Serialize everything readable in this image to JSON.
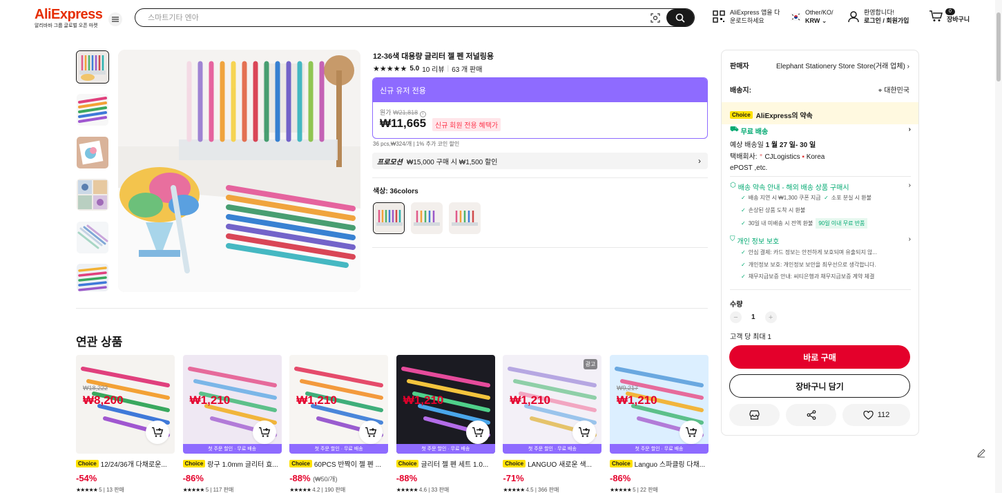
{
  "header": {
    "logo": "AliExpress",
    "logo_tagline": "알리바바 그룹 글로벌 오픈 마켓",
    "search_placeholder": "스마트기타 엔아",
    "app_download_line1": "AliExpress 앱을 다",
    "app_download_line2": "운로드하세요",
    "locale_line1": "Other/KO/",
    "locale_line2": "KRW",
    "account_line1": "환영합니다!",
    "account_line2": "로그인 / 회원가입",
    "cart_count": "0",
    "cart_label": "장바구니"
  },
  "product": {
    "title": "12-36색 대용량 글리터 젤 펜 저널링용",
    "rating": "5.0",
    "reviews": "10 리뷰",
    "sold": "63 개 판매",
    "promo_header": "신규 유저 전용",
    "original_label": "원가",
    "original_price": "₩21,818",
    "price": "₩11,665",
    "new_member_badge": "신규 회원 전용 혜택가",
    "per_pcs": "36 pcs,₩324/개 | 1% 추가 코인 할인",
    "promotion_label": "프로모션",
    "promotion_text": "₩15,000 구매 시 ₩1,500 할인",
    "color_label": "색상: 36colors"
  },
  "panel": {
    "seller_label": "판매자",
    "seller_name": "Elephant Stationery Store Store(거래 업체)",
    "ship_to_label": "배송지:",
    "ship_to_value": "대한민국",
    "choice_badge": "Choice",
    "choice_title": "AliExpress의 약속",
    "free_shipping": "무료 배송",
    "delivery_prefix": "예상 배송일",
    "delivery_dates": "1 월 27 일- 30 일",
    "courier_prefix": "택배회사:",
    "courier_1": "CJLogistics",
    "courier_2": "Korea",
    "courier_3": "ePOST ,etc.",
    "guarantee_title": "배송 약속 안내 - 해외 배송 상품 구매시",
    "guarantee_1": "배송 지연 시 ₩1,300 쿠폰 지급",
    "guarantee_2": "소포 분실 시 환불",
    "guarantee_3": "손상된 상품 도착 시 환불",
    "guarantee_4": "30일 내 미배송 시 전액 환불",
    "guarantee_4_badge": "90일 이내 무료 반품",
    "privacy_title": "개인 정보 보호",
    "privacy_1": "안심 결제: 카드 정보는 안전하게 보호되며 유출되지 않...",
    "privacy_2": "개인정보 보호: 개인정보 보안을 최우선으로 생각합니다.",
    "privacy_3": "채무지급보증 안내: 씨티은행과 채무지급보증 계약 체결",
    "qty_label": "수량",
    "qty_value": "1",
    "qty_max": "고객 당 최대 1",
    "buy_now": "바로 구매",
    "add_to_cart": "장바구니 담기",
    "wishlist_count": "112"
  },
  "related": {
    "title": "연관 상품",
    "items": [
      {
        "name": "12/24/36개 다채로운...",
        "discount": "-54%",
        "price": "₩8,200",
        "orig": "₩18,222",
        "rating": "5",
        "sold": "13 판매",
        "band": ""
      },
      {
        "name": "랑구 1.0mm 글리터 효...",
        "discount": "-86%",
        "price": "₩1,210",
        "orig": "",
        "rating": "5",
        "sold": "117 판매",
        "band": "첫 주문 할인 · 무료 배송"
      },
      {
        "name": "60PCS 반짝이 젤 펜 ...",
        "discount": "-88%",
        "price": "₩1,210",
        "orig": "(₩50/개)",
        "rating": "4.2",
        "sold": "190 판매",
        "band": "첫 주문 할인 · 무료 배송"
      },
      {
        "name": "글리터 젤 펜 세트 1.0...",
        "discount": "-88%",
        "price": "₩1,210",
        "orig": "",
        "rating": "4.6",
        "sold": "33 판매",
        "band": "첫 주문 할인 · 무료 배송"
      },
      {
        "name": "LANGUO 새로운 색...",
        "discount": "-71%",
        "price": "₩1,210",
        "orig": "",
        "rating": "4.5",
        "sold": "366 판매",
        "band": "첫 주문 할인 · 무료 배송",
        "ad": "광고"
      },
      {
        "name": "Languo 스파클링 다채...",
        "discount": "-86%",
        "price": "₩1,210",
        "orig": "₩9,217",
        "rating": "5",
        "sold": "22 판매",
        "band": "첫 주문 할인 · 무료 배송"
      }
    ],
    "choice_tag": "Choice"
  },
  "colors": {
    "accent_purple": "#8e6bff",
    "buy_red": "#e4002b",
    "green": "#01a971",
    "choice_yellow": "#ffe100"
  }
}
